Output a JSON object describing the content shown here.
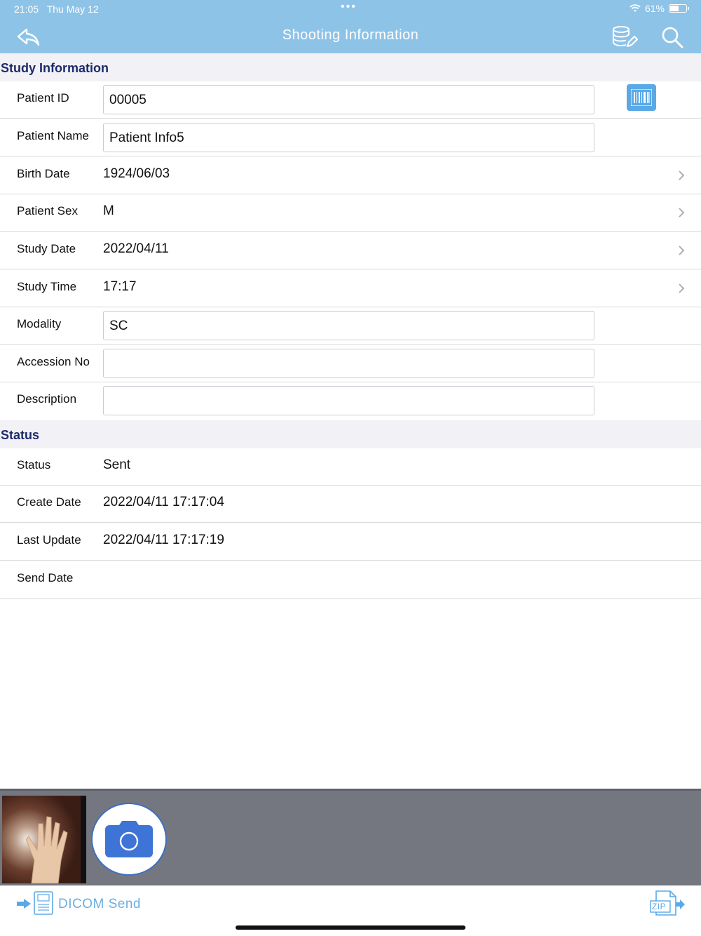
{
  "status_bar": {
    "time": "21:05",
    "date": "Thu May 12",
    "battery": "61%",
    "battery_level": 0.61
  },
  "nav": {
    "title": "Shooting Information",
    "back_icon": "reply-arrow-icon",
    "db_icon": "database-edit-icon",
    "search_icon": "search-icon"
  },
  "study_section": {
    "title": "Study Information"
  },
  "study_rows": {
    "patient_id": {
      "label": "Patient ID",
      "value": "00005",
      "placeholder": ""
    },
    "patient_name": {
      "label": "Patient Name",
      "value": "Patient Info5",
      "placeholder": ""
    },
    "birth_date": {
      "label": "Birth Date",
      "value": "1924/06/03"
    },
    "patient_sex": {
      "label": "Patient Sex",
      "value": "M"
    },
    "study_date": {
      "label": "Study Date",
      "value": "2022/04/11"
    },
    "study_time": {
      "label": "Study Time",
      "value": "17:17"
    },
    "modality": {
      "label": "Modality",
      "value": "SC",
      "placeholder": ""
    },
    "accession_no": {
      "label": "Accession No",
      "value": "",
      "placeholder": ""
    },
    "description": {
      "label": "Description",
      "value": "",
      "placeholder": ""
    }
  },
  "status_section": {
    "title": "Status"
  },
  "status_rows": {
    "status": {
      "label": "Status",
      "value": "Sent"
    },
    "create_date": {
      "label": "Create Date",
      "value": "2022/04/11 17:17:04"
    },
    "last_update": {
      "label": "Last Update",
      "value": "2022/04/11 17:17:19"
    },
    "send_date": {
      "label": "Send Date",
      "value": ""
    }
  },
  "toolbar": {
    "send_label": "DICOM Send",
    "zip_label": "ZIP"
  },
  "colors": {
    "nav_bg": "#8ec3e8",
    "accent": "#5aa9e6",
    "section_title": "#1c2a6b",
    "panel_bg": "#74777f"
  }
}
